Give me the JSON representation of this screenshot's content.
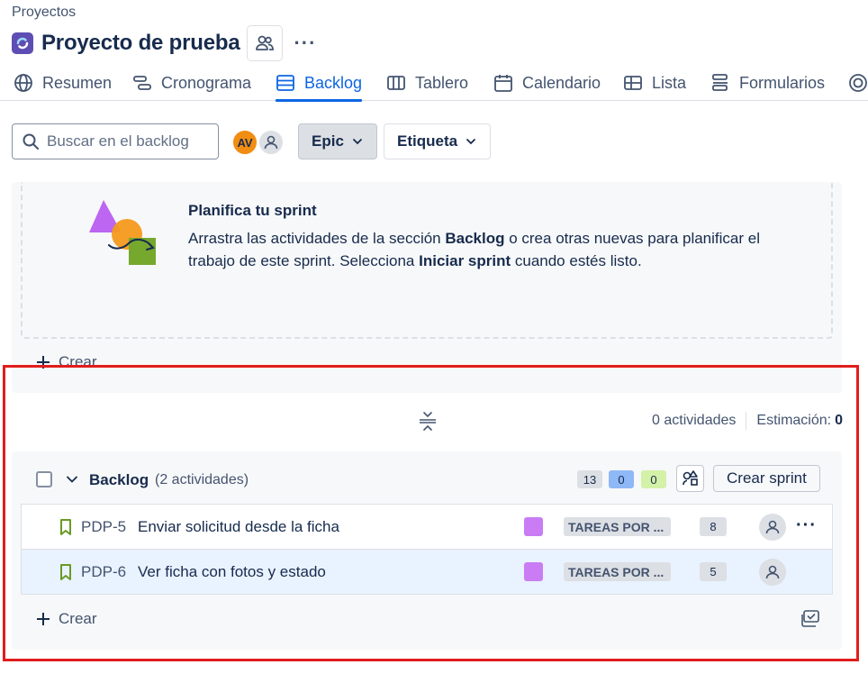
{
  "breadcrumb": "Proyectos",
  "project": {
    "title": "Proyecto de prueba",
    "icon": "project-icon",
    "more": "···"
  },
  "tabs": [
    {
      "label": "Resumen",
      "icon": "globe-icon"
    },
    {
      "label": "Cronograma",
      "icon": "timeline-icon"
    },
    {
      "label": "Backlog",
      "icon": "backlog-icon",
      "active": true
    },
    {
      "label": "Tablero",
      "icon": "board-icon"
    },
    {
      "label": "Calendario",
      "icon": "calendar-icon"
    },
    {
      "label": "Lista",
      "icon": "list-icon"
    },
    {
      "label": "Formularios",
      "icon": "forms-icon"
    }
  ],
  "toolbar": {
    "search_placeholder": "Buscar en el backlog",
    "avatar_initials": "AV",
    "epic_label": "Epic",
    "tag_label": "Etiqueta"
  },
  "sprint": {
    "plan_title": "Planifica tu sprint",
    "plan_text_1": "Arrastra las actividades de la sección ",
    "plan_text_bold_1": "Backlog",
    "plan_text_2": " o crea otras nuevas para planificar el trabajo de este sprint. Selecciona ",
    "plan_text_bold_2": "Iniciar sprint",
    "plan_text_3": " cuando estés listo.",
    "create_label": "Crear",
    "activities": "0 actividades",
    "estimation_label": "Estimación:",
    "estimation_value": "0"
  },
  "backlog": {
    "title": "Backlog",
    "count": "(2 actividades)",
    "todo_count": "13",
    "inprogress_count": "0",
    "done_count": "0",
    "create_sprint_label": "Crear sprint",
    "create_label": "Crear",
    "issues": [
      {
        "key": "PDP-5",
        "summary": "Enviar solicitud desde la ficha",
        "status": "TAREAS POR ...",
        "points": "8",
        "epic_color": "#c97cf4"
      },
      {
        "key": "PDP-6",
        "summary": "Ver ficha con fotos y estado",
        "status": "TAREAS POR ...",
        "points": "5",
        "epic_color": "#c97cf4"
      }
    ]
  },
  "colors": {
    "accent": "#0c66e4",
    "highlight_border": "#e11d1d",
    "story_icon": "#6a9a23"
  }
}
